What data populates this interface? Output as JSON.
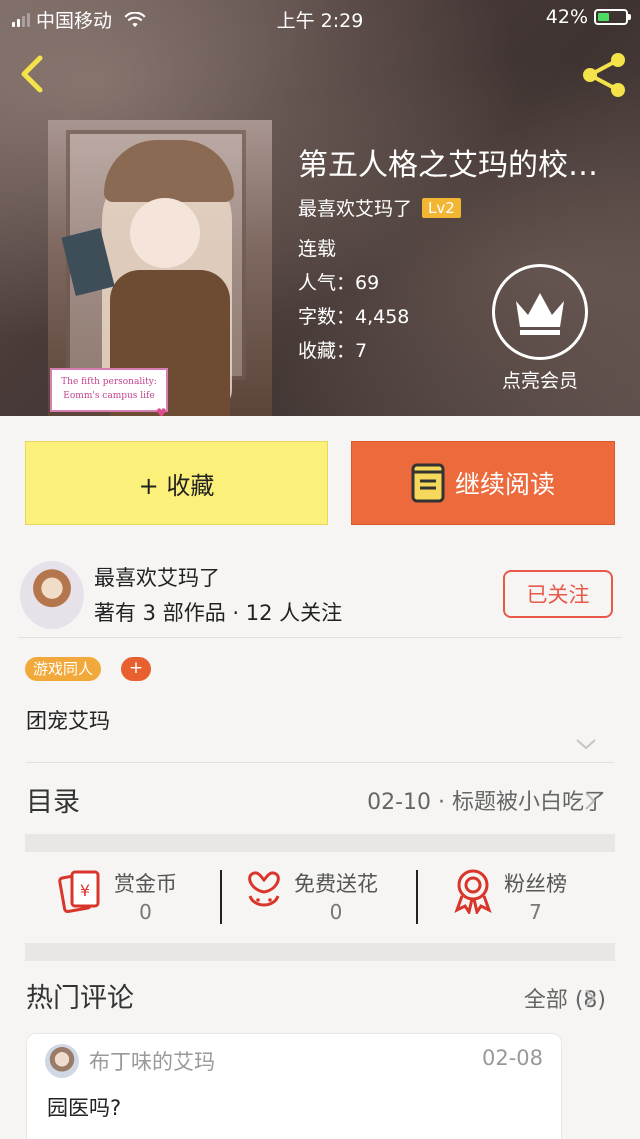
{
  "status_bar": {
    "carrier": "中国移动",
    "time": "上午 2:29",
    "battery": "42%",
    "battery_level": 0.42
  },
  "book": {
    "title": "第五人格之艾玛的校…",
    "author": "最喜欢艾玛了",
    "level": "Lv2",
    "status": "连载",
    "popularity": "人气：69",
    "word_count": "字数：4,458",
    "favorites": "收藏：7",
    "cover_caption_line1": "The fifth personality:",
    "cover_caption_line2": "Eomm's campus life"
  },
  "vip": {
    "label": "点亮会员"
  },
  "actions": {
    "favorite_label": "+ 收藏",
    "read_label": "继续阅读"
  },
  "author_card": {
    "name": "最喜欢艾玛了",
    "meta": "著有 3 部作品 · 12 人关注",
    "follow_label": "已关注"
  },
  "tags": {
    "items": [
      "游戏同人"
    ],
    "add_label": "+"
  },
  "description": "团宠艾玛",
  "toc": {
    "label": "目录",
    "latest": "02-10 · 标题被小白吃了"
  },
  "stats": [
    {
      "label": "赏金币",
      "value": "0",
      "icon": "red-envelope-icon"
    },
    {
      "label": "免费送花",
      "value": "0",
      "icon": "flower-icon"
    },
    {
      "label": "粉丝榜",
      "value": "7",
      "icon": "medal-icon"
    }
  ],
  "comments": {
    "section_label": "热门评论",
    "all_label": "全部 (8)",
    "items": [
      {
        "user": "布丁味的艾玛",
        "date": "02-08",
        "text": "园医吗?"
      }
    ]
  },
  "colors": {
    "accent_orange": "#ec6a3c",
    "favorite_yellow": "#fbf07a",
    "level_badge": "#f2b632",
    "follow_red": "#e8594a",
    "icon_red": "#d9362b"
  }
}
